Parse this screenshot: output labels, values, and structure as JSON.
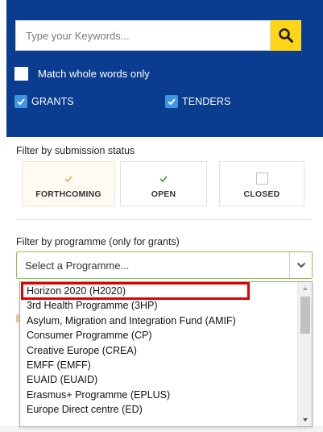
{
  "search": {
    "placeholder": "Type your Keywords...",
    "match_label": "Match whole words only",
    "types": [
      {
        "label": "GRANTS",
        "checked": true
      },
      {
        "label": "TENDERS",
        "checked": true
      }
    ]
  },
  "status": {
    "title": "Filter by submission status",
    "options": [
      {
        "label": "FORTHCOMING",
        "checked": true
      },
      {
        "label": "OPEN",
        "checked": true
      },
      {
        "label": "CLOSED",
        "checked": false
      }
    ]
  },
  "programme": {
    "title": "Filter by programme (only for grants)",
    "selected": "Select a Programme...",
    "options": [
      "Horizon 2020 (H2020)",
      "3rd Health Programme (3HP)",
      "Asylum, Migration and Integration Fund (AMIF)",
      "Consumer Programme (CP)",
      "Creative Europe (CREA)",
      "EMFF (EMFF)",
      "EUAID (EUAID)",
      "Erasmus+ Programme (EPLUS)",
      "Europe Direct centre (ED)"
    ]
  },
  "colors": {
    "panel": "#0a3c8f",
    "search_button": "#ffd617",
    "checkbox": "#3f94e6",
    "forthcoming_check": "#f0a43c",
    "open_check": "#2f8f2f",
    "select_border": "#8fc24a",
    "highlight": "#e00000"
  }
}
